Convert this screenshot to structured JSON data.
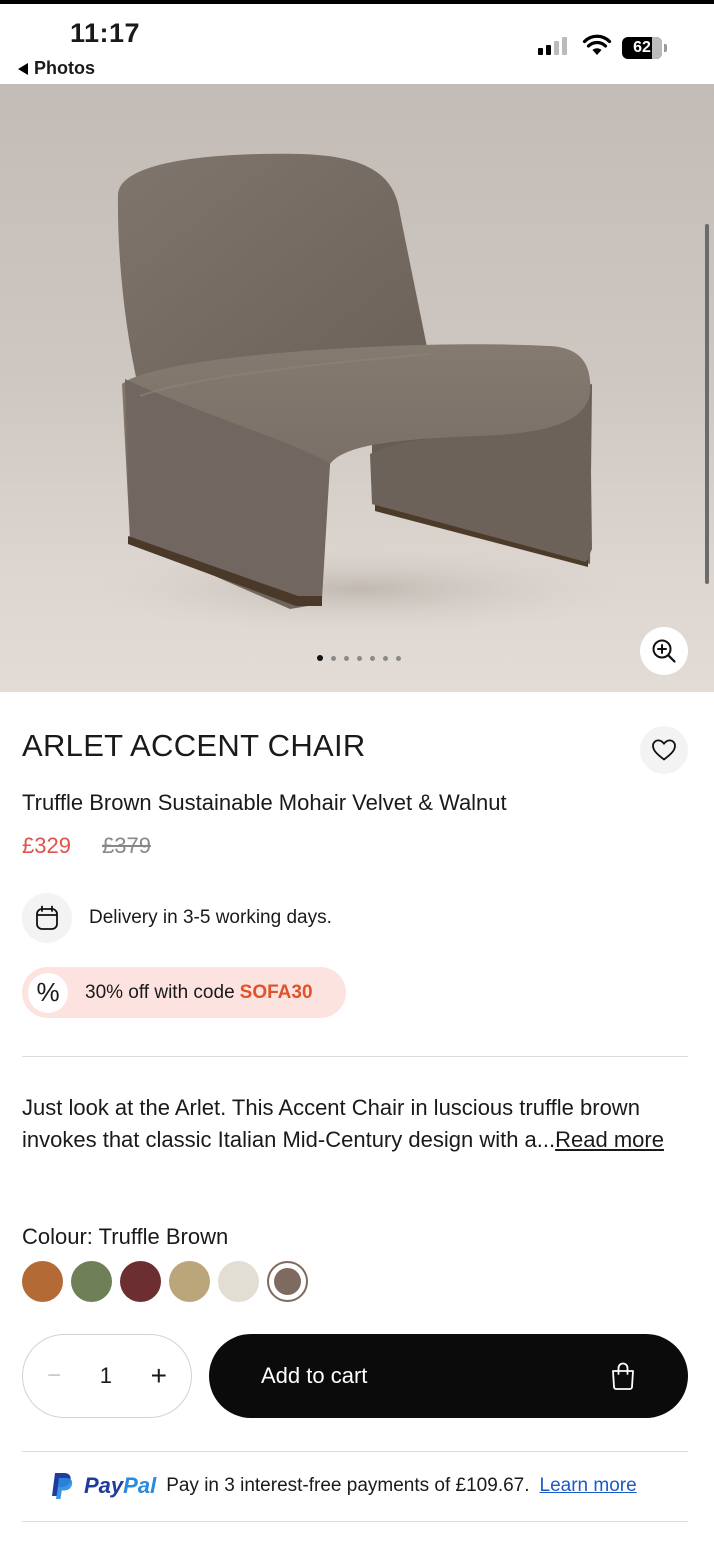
{
  "status_bar": {
    "time": "11:17",
    "back_label": "Photos",
    "battery": "62"
  },
  "gallery": {
    "total_images": 7,
    "active_index": 0
  },
  "product": {
    "title": "ARLET ACCENT CHAIR",
    "subtitle": "Truffle Brown Sustainable Mohair Velvet & Walnut",
    "price": "£329",
    "old_price": "£379",
    "delivery": "Delivery in 3-5 working days.",
    "promo_text": "30% off with code",
    "promo_code": "SOFA30",
    "promo_icon": "%",
    "description": "Just look at the Arlet. This Accent Chair in luscious truffle brown invokes that classic Italian Mid-Century design with a...",
    "read_more": "Read more",
    "colour_label": "Colour: Truffle Brown",
    "swatches": [
      "#b46a34",
      "#6f8058",
      "#6c2e30",
      "#bba57a",
      "#e3ded3",
      "#7e6a60"
    ],
    "selected_swatch": 5
  },
  "purchase": {
    "minus": "−",
    "quantity": "1",
    "plus": "+",
    "add_to_cart": "Add to cart"
  },
  "paypal": {
    "brand_pay": "Pay",
    "brand_pal": "Pal",
    "text": "Pay in 3 interest-free payments of £109.67.",
    "learn_more": "Learn more"
  }
}
